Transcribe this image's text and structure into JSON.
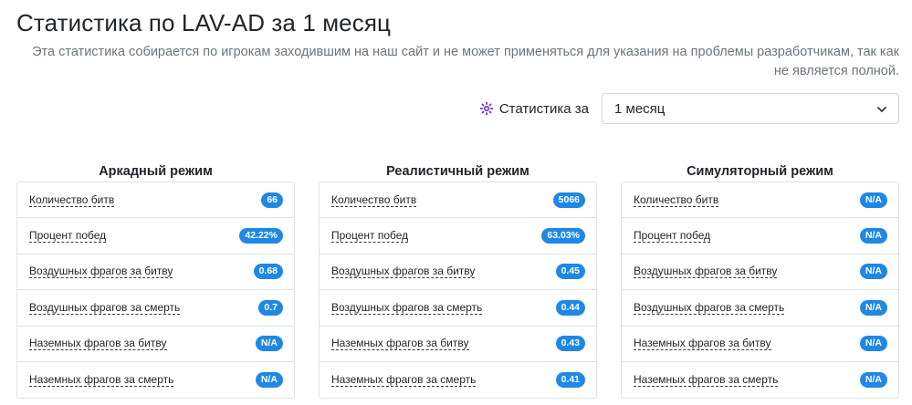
{
  "header": {
    "title": "Статистика по LAV-AD за 1 месяц",
    "disclaimer": "Эта статистика собирается по игрокам заходившим на наш сайт и не может применяться для указания на проблемы разработчикам, так как не является полной."
  },
  "period": {
    "icon": "gear-icon",
    "label": "Статистика за",
    "selected": "1 месяц",
    "accent_color": "#7b4fb5"
  },
  "colors": {
    "badge": "#1e88e5",
    "border": "#dee2e6"
  },
  "modes": [
    {
      "title": "Аркадный режим",
      "rows": [
        {
          "label": "Количество битв",
          "value": "66"
        },
        {
          "label": "Процент побед",
          "value": "42.22%"
        },
        {
          "label": "Воздушных фрагов за битву",
          "value": "0.68"
        },
        {
          "label": "Воздушных фрагов за смерть",
          "value": "0.7"
        },
        {
          "label": "Наземных фрагов за битву",
          "value": "N/A"
        },
        {
          "label": "Наземных фрагов за смерть",
          "value": "N/A"
        }
      ]
    },
    {
      "title": "Реалистичный режим",
      "rows": [
        {
          "label": "Количество битв",
          "value": "5066"
        },
        {
          "label": "Процент побед",
          "value": "63.03%"
        },
        {
          "label": "Воздушных фрагов за битву",
          "value": "0.45"
        },
        {
          "label": "Воздушных фрагов за смерть",
          "value": "0.44"
        },
        {
          "label": "Наземных фрагов за битву",
          "value": "0.43"
        },
        {
          "label": "Наземных фрагов за смерть",
          "value": "0.41"
        }
      ]
    },
    {
      "title": "Симуляторный режим",
      "rows": [
        {
          "label": "Количество битв",
          "value": "N/A"
        },
        {
          "label": "Процент побед",
          "value": "N/A"
        },
        {
          "label": "Воздушных фрагов за битву",
          "value": "N/A"
        },
        {
          "label": "Воздушных фрагов за смерть",
          "value": "N/A"
        },
        {
          "label": "Наземных фрагов за битву",
          "value": "N/A"
        },
        {
          "label": "Наземных фрагов за смерть",
          "value": "N/A"
        }
      ]
    }
  ]
}
